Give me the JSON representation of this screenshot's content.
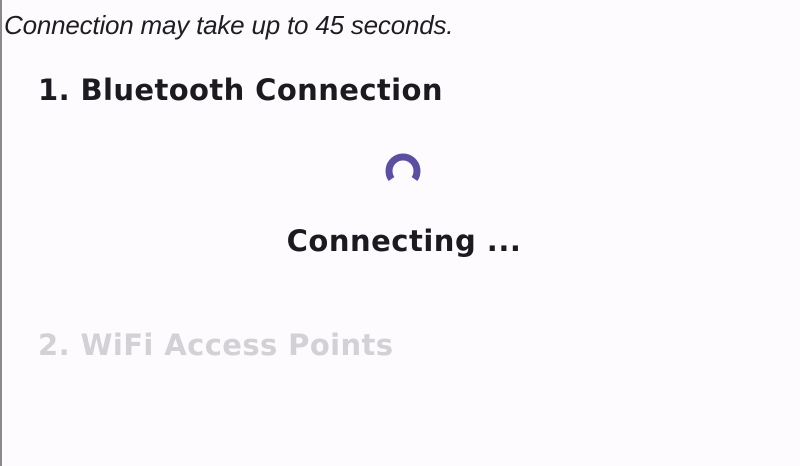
{
  "notice": "Connection may take up to 45 seconds.",
  "steps": [
    {
      "label": "1. Bluetooth Connection",
      "state": "active"
    },
    {
      "label": "2. WiFi Access Points",
      "state": "pending"
    }
  ],
  "status": {
    "text": "Connecting ...",
    "icon": "loading-spinner-icon"
  },
  "colors": {
    "accent": "#5b4fa0",
    "active_text": "#1c1a20",
    "inactive_text": "#d3d1d5",
    "background": "#fdfbfd"
  }
}
